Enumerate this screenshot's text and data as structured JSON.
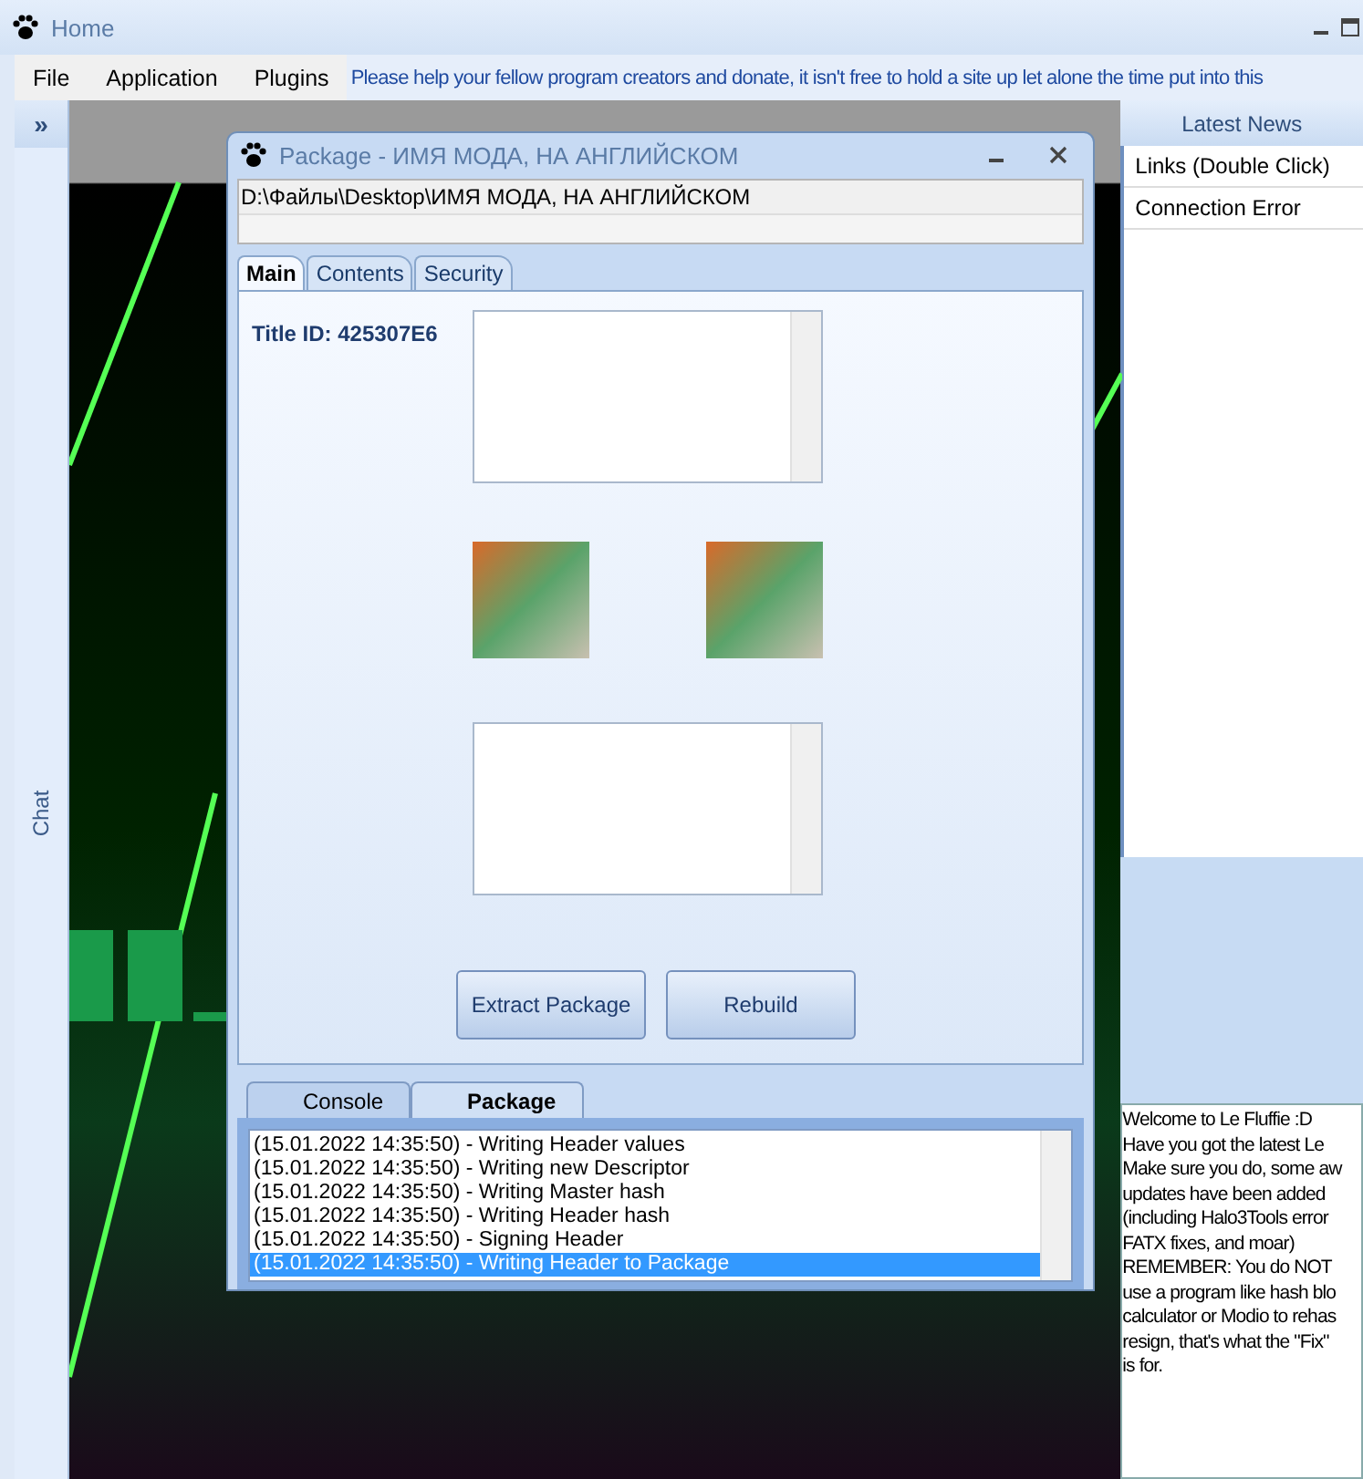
{
  "window": {
    "title": "Home"
  },
  "menu": [
    {
      "label": "File"
    },
    {
      "label": "Application"
    },
    {
      "label": "Plugins"
    }
  ],
  "donate_banner": "Please help your fellow program creators and donate, it isn't free to hold a site up let alone the time put into this",
  "sidebar": {
    "toggle": "»",
    "label": "Chat"
  },
  "news": {
    "header": "Latest News",
    "items": [
      {
        "label": "Links (Double Click)"
      },
      {
        "label": "Connection Error"
      }
    ],
    "message_lines": [
      "Welcome to Le Fluffie :D",
      "Have you got the latest Le",
      "Make sure you do, some aw",
      "updates have been added",
      "(including Halo3Tools error",
      "FATX fixes, and moar)",
      "REMEMBER: You do NOT",
      "use a program like hash blo",
      "calculator or Modio to rehas",
      "resign, that's what the \"Fix\"",
      "is for."
    ]
  },
  "dialog": {
    "title": "Package - ИМЯ МОДА, НА АНГЛИЙСКОМ",
    "path": "D:\\Файлы\\Desktop\\ИМЯ МОДА, НА АНГЛИЙСКОМ",
    "tabs": [
      {
        "label": "Main",
        "selected": true
      },
      {
        "label": "Contents",
        "selected": false
      },
      {
        "label": "Security",
        "selected": false
      }
    ],
    "title_id": "Title ID: 425307E6",
    "buttons": [
      "Extract Package",
      "Rebuild"
    ],
    "log_tabs": [
      {
        "label": "Console",
        "selected": false
      },
      {
        "label": "Package",
        "selected": true
      }
    ],
    "log": [
      {
        "text": "(15.01.2022 14:35:50) - Writing Header values",
        "selected": false
      },
      {
        "text": "(15.01.2022 14:35:50) - Writing new Descriptor",
        "selected": false
      },
      {
        "text": "(15.01.2022 14:35:50) - Writing Master hash",
        "selected": false
      },
      {
        "text": "(15.01.2022 14:35:50) - Writing Header hash",
        "selected": false
      },
      {
        "text": "(15.01.2022 14:35:50) - Signing Header",
        "selected": false
      },
      {
        "text": "(15.01.2022 14:35:50) - Writing Header to Package",
        "selected": true
      }
    ]
  }
}
